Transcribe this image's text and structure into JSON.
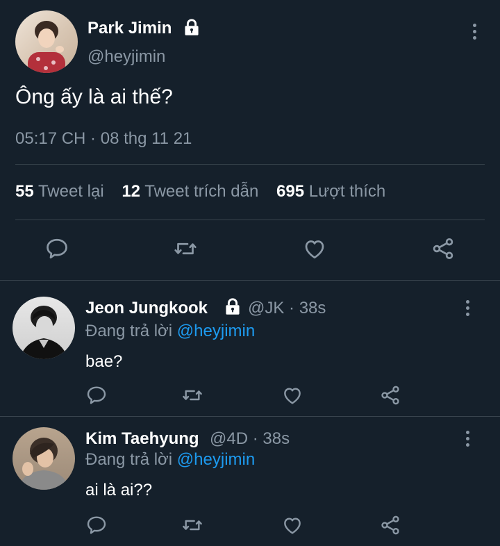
{
  "main_tweet": {
    "display_name": "Park Jimin",
    "handle": "@heyjimin",
    "text": "Ông ấy là ai thế?",
    "timestamp": "05:17 CH · 08 thg 11 21",
    "stats": [
      {
        "count": "55",
        "label": "Tweet lại"
      },
      {
        "count": "12",
        "label": "Tweet trích dẫn"
      },
      {
        "count": "695",
        "label": "Lượt thích"
      }
    ]
  },
  "replies": [
    {
      "display_name": "Jeon Jungkook",
      "handle_time": "@JK · 38s",
      "replying_prefix": "Đang trả lời",
      "replying_to": "@heyjimin",
      "text": "bae?"
    },
    {
      "display_name": "Kim Taehyung",
      "handle_time": "@4D · 38s",
      "replying_prefix": "Đang trả lời",
      "replying_to": "@heyjimin",
      "text": "ai là ai??"
    }
  ],
  "icons": [
    "lock-icon",
    "more-icon",
    "reply-icon",
    "retweet-icon",
    "like-icon",
    "share-icon"
  ],
  "colors": {
    "background": "#15202b",
    "text": "#ffffff",
    "muted": "#8b98a5",
    "link": "#1d9bf0",
    "divider": "#38444d"
  }
}
